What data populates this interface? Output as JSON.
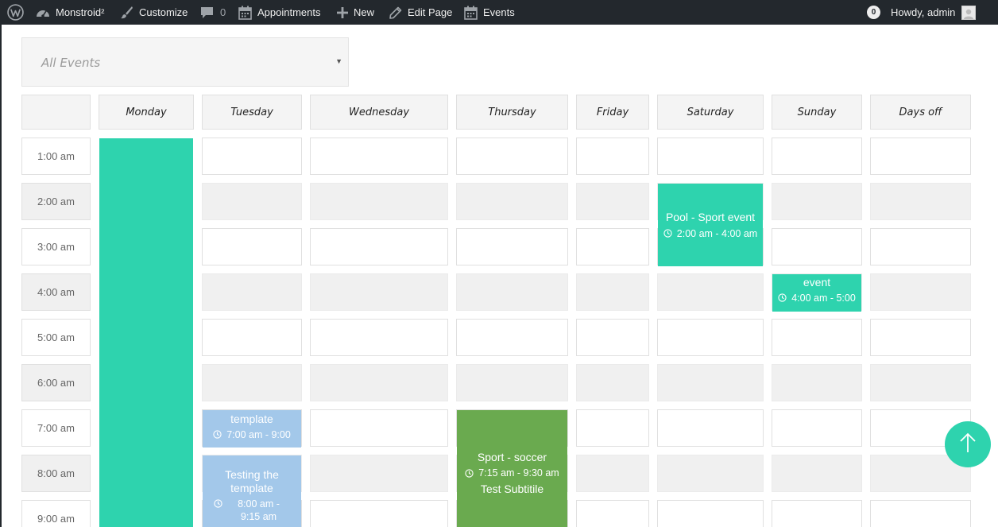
{
  "adminbar": {
    "site_name": "Monstroid²",
    "customize": "Customize",
    "comments_count": "0",
    "appointments": "Appointments",
    "new": "New",
    "edit_page": "Edit Page",
    "events": "Events",
    "notifications": "0",
    "howdy": "Howdy, admin"
  },
  "filter": {
    "selected": "All Events"
  },
  "days": [
    "Monday",
    "Tuesday",
    "Wednesday",
    "Thursday",
    "Friday",
    "Saturday",
    "Sunday",
    "Days off"
  ],
  "times": [
    "1:00 am",
    "2:00 am",
    "3:00 am",
    "4:00 am",
    "5:00 am",
    "6:00 am",
    "7:00 am",
    "8:00 am",
    "9:00 am"
  ],
  "events": {
    "pool": {
      "title": "Pool - Sport event",
      "time": "2:00 am - 4:00 am"
    },
    "sunday": {
      "title": "event",
      "time": "4:00 am - 5:00"
    },
    "tuesday_first": {
      "title": "template",
      "time": "7:00 am - 9:00"
    },
    "tuesday_second": {
      "title": "Testing the template",
      "time": "8:00 am - 9:15 am"
    },
    "soccer": {
      "title": "Sport - soccer",
      "time": "7:15 am - 9:30 am",
      "subtitle": "Test Subtitile"
    }
  },
  "colors": {
    "teal": "#2ed3ae",
    "blue": "#a3c8ea",
    "green": "#6aaa4f",
    "adminbar": "#23282d"
  },
  "icons": {
    "wordpress": "wordpress-logo-icon",
    "dashboard": "dashboard-icon",
    "brush": "customize-brush-icon",
    "comment": "comment-icon",
    "calendar": "calendar-icon",
    "plus": "plus-icon",
    "pencil": "pencil-icon",
    "clock": "clock-icon",
    "arrow_up": "arrow-up-icon"
  }
}
